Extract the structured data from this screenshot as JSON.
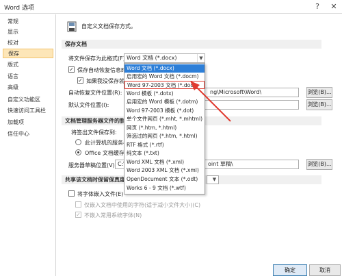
{
  "window": {
    "title": "Word 选项",
    "help_glyph": "?",
    "close_glyph": "✕"
  },
  "sidebar": {
    "items": [
      {
        "label": "常规"
      },
      {
        "label": "显示"
      },
      {
        "label": "校对"
      },
      {
        "label": "保存",
        "active": true
      },
      {
        "label": "版式"
      },
      {
        "label": "语言"
      },
      {
        "label": "高级"
      },
      {
        "label": "自定义功能区"
      },
      {
        "label": "快速访问工具栏"
      },
      {
        "label": "加载项"
      },
      {
        "label": "信任中心"
      }
    ]
  },
  "header": {
    "text": "自定义文档保存方式。",
    "icon": "save-document-icon"
  },
  "save_section": {
    "title": "保存文档",
    "format_label": "将文件保存为此格式(F):",
    "format_value": "Word 文档 (*.docx)",
    "autorecover_label": "保存自动恢复信息时间",
    "keep_last_label": "如果我没保存就关",
    "autorecover_location_label": "自动恢复文件位置(R):",
    "autorecover_location_value": "ng\\Microsoft\\Word\\",
    "default_location_label": "默认文件位置(I):",
    "browse_label": "浏览(B)..."
  },
  "server_section": {
    "title": "文档管理服务器文件的脱机",
    "checkout_label": "将签出文件保存到:",
    "option_server": "此计算机的服务器",
    "option_office": "Office 文档缓存(",
    "drafts_label": "服务器草稿位置(V):",
    "drafts_value_left": "C:\\",
    "drafts_value_right": "oint 草稿\\",
    "browse_label": "浏览(B)..."
  },
  "fidelity_section": {
    "title": "共享该文档时保留保真度(",
    "embed_fonts_label": "将字体嵌入文件(E)",
    "embed_used_label": "仅嵌入文档中使用的字符(适于减小文件大小)(C)",
    "no_common_label": "不嵌入常用系统字体(N)"
  },
  "format_dropdown": {
    "items": [
      {
        "label": "Word 文档 (*.docx)",
        "selected": true
      },
      {
        "label": "启用宏的 Word 文档 (*.docm)"
      },
      {
        "label": "Word 97-2003 文档 (*.doc)",
        "highlighted": true
      },
      {
        "label": "Word 模板 (*.dotx)"
      },
      {
        "label": "启用宏的 Word 模板 (*.dotm)"
      },
      {
        "label": "Word 97-2003 模板 (*.dot)"
      },
      {
        "label": "单个文件网页 (*.mht, *.mhtml)"
      },
      {
        "label": "网页 (*.htm, *.html)"
      },
      {
        "label": "筛选过的网页 (*.htm, *.html)"
      },
      {
        "label": "RTF 格式 (*.rtf)"
      },
      {
        "label": "纯文本 (*.txt)"
      },
      {
        "label": "Word XML 文档 (*.xml)"
      },
      {
        "label": "Word 2003 XML 文档 (*.xml)"
      },
      {
        "label": "OpenDocument 文本 (*.odt)"
      },
      {
        "label": "Works 6 - 9 文档 (*.wtf)"
      }
    ]
  },
  "footer": {
    "ok_label": "确定",
    "cancel_label": "取消"
  },
  "colors": {
    "accent": "#2d7fd8",
    "annotation_red": "#e03a2f",
    "active_nav": "#fde6b8"
  }
}
